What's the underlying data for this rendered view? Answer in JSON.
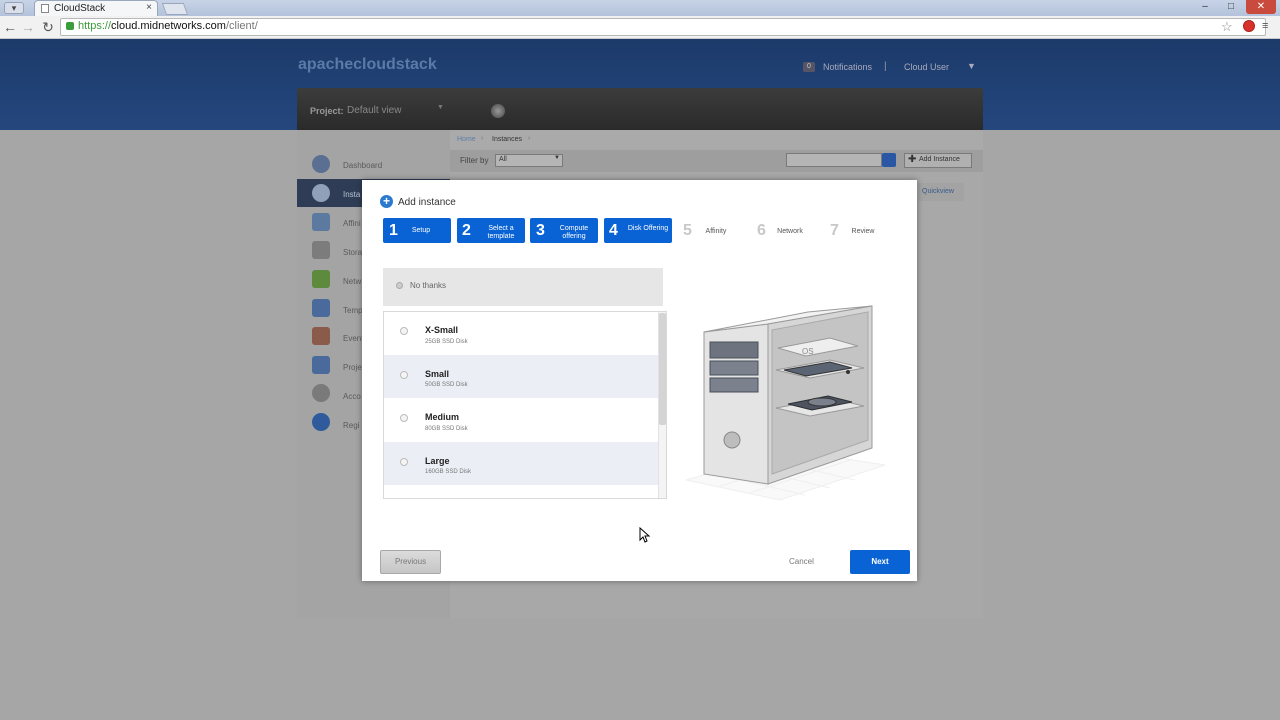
{
  "browser": {
    "tab_title": "CloudStack",
    "tab_close": "×",
    "menu_glyph": "▾",
    "url_scheme": "https://",
    "url_host": "cloud.midnetworks.com",
    "url_path": "/client/",
    "window_controls": [
      "–",
      "□",
      "✕"
    ]
  },
  "app": {
    "logo": "apachecloudstack",
    "notifications_count": "0",
    "notifications_label": "Notifications",
    "separator": "|",
    "user_label": "Cloud User",
    "user_arrow": "▼",
    "project_label": "Project:",
    "project_value": "Default view",
    "project_arrow": "▼"
  },
  "sidebar": {
    "items": [
      {
        "label": "Dashboard",
        "icon": "dashboard-icon"
      },
      {
        "label": "Insta",
        "icon": "cloud-icon"
      },
      {
        "label": "Affini",
        "icon": "affinity-icon"
      },
      {
        "label": "Stora",
        "icon": "storage-icon"
      },
      {
        "label": "Netw",
        "icon": "network-icon"
      },
      {
        "label": "Temp",
        "icon": "template-icon"
      },
      {
        "label": "Event",
        "icon": "calendar-icon"
      },
      {
        "label": "Proje",
        "icon": "folder-icon"
      },
      {
        "label": "Acco",
        "icon": "user-icon"
      },
      {
        "label": "Regi",
        "icon": "globe-icon"
      }
    ]
  },
  "breadcrumb": {
    "home": "Home",
    "sep": "›",
    "instances": "Instances"
  },
  "filter": {
    "label": "Filter by",
    "value": "All",
    "arrow": "▼"
  },
  "toolbar": {
    "add_instance": "Add Instance",
    "add_plus": "✚"
  },
  "table": {
    "quickview": "Quickview"
  },
  "modal": {
    "title": "Add instance",
    "add_glyph": "+",
    "steps": [
      {
        "num": "1",
        "label": "Setup",
        "active": true
      },
      {
        "num": "2",
        "label": "Select a template",
        "active": true
      },
      {
        "num": "3",
        "label": "Compute offering",
        "active": true
      },
      {
        "num": "4",
        "label": "Disk Offering",
        "active": true
      },
      {
        "num": "5",
        "label": "Affinity",
        "active": false
      },
      {
        "num": "6",
        "label": "Network",
        "active": false
      },
      {
        "num": "7",
        "label": "Review",
        "active": false
      }
    ],
    "no_thanks": "No thanks",
    "disk_offerings": [
      {
        "name": "X-Small",
        "desc": "25GB SSD Disk"
      },
      {
        "name": "Small",
        "desc": "50GB SSD Disk"
      },
      {
        "name": "Medium",
        "desc": "80GB SSD Disk"
      },
      {
        "name": "Large",
        "desc": "160GB SSD Disk"
      }
    ],
    "illustration_label": "OS",
    "previous": "Previous",
    "cancel": "Cancel",
    "next": "Next"
  },
  "colors": {
    "accent": "#0a63d4",
    "header": "#1c3a6a"
  }
}
